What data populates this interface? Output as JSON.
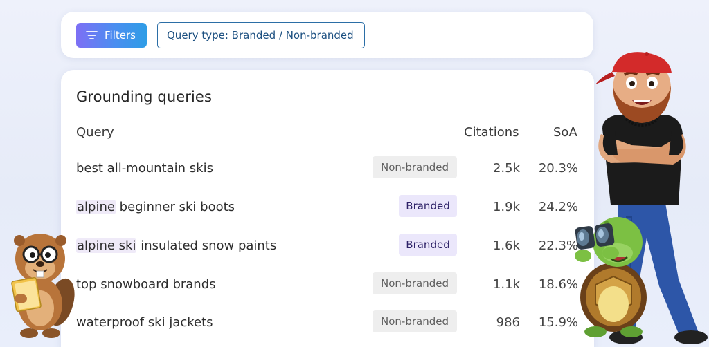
{
  "filter_bar": {
    "filters_label": "Filters",
    "query_type_label": "Query type: Branded / Non-branded"
  },
  "card": {
    "title": "Grounding queries",
    "columns": {
      "query": "Query",
      "citations": "Citations",
      "soa": "SoA"
    },
    "rows": [
      {
        "highlight": "",
        "rest": "best all-mountain skis",
        "badge": "Non-branded",
        "citations": "2.5k",
        "soa": "20.3%"
      },
      {
        "highlight": "alpine",
        "rest": " beginner ski boots",
        "badge": "Branded",
        "citations": "1.9k",
        "soa": "24.2%"
      },
      {
        "highlight": "alpine ski",
        "rest": " insulated snow paints",
        "badge": "Branded",
        "citations": "1.6k",
        "soa": "22.3%"
      },
      {
        "highlight": "",
        "rest": "top snowboard brands",
        "badge": "Non-branded",
        "citations": "1.1k",
        "soa": "18.6%"
      },
      {
        "highlight": "",
        "rest": "waterproof ski jackets",
        "badge": "Non-branded",
        "citations": "986",
        "soa": "15.9%"
      }
    ]
  },
  "colors": {
    "filters_button": "#4a8ef0",
    "query_type_border": "#2b6ea6",
    "branded_badge": "#ebe7fb",
    "non_branded_badge": "#eeeeee",
    "highlight": "#efeaf8"
  },
  "illustrations": [
    "beaver-mascot",
    "man-with-cap-mascot",
    "turtle-with-binoculars-mascot"
  ]
}
